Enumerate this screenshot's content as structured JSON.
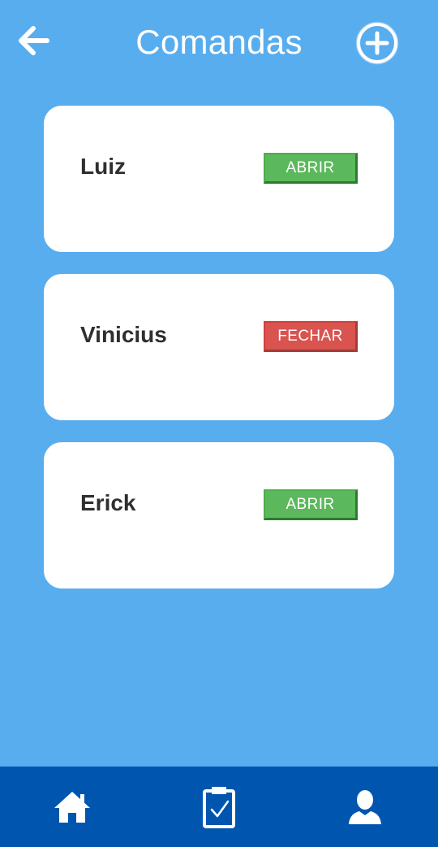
{
  "header": {
    "title": "Comandas",
    "back_icon": "arrow-left-icon",
    "add_icon": "plus-circle-icon"
  },
  "comandas": [
    {
      "name": "Luiz",
      "action_label": "ABRIR",
      "action_type": "open",
      "action_color": "#5CB85C"
    },
    {
      "name": "Vinicius",
      "action_label": "FECHAR",
      "action_type": "close",
      "action_color": "#D9534F"
    },
    {
      "name": "Erick",
      "action_label": "ABRIR",
      "action_type": "open",
      "action_color": "#5CB85C"
    }
  ],
  "bottom_nav": {
    "items": [
      {
        "icon": "home-icon"
      },
      {
        "icon": "clipboard-check-icon"
      },
      {
        "icon": "user-icon"
      }
    ],
    "background": "#0055AF"
  },
  "colors": {
    "background": "#58ADEF",
    "card": "#FFFFFF",
    "text": "#2F2F2F"
  }
}
